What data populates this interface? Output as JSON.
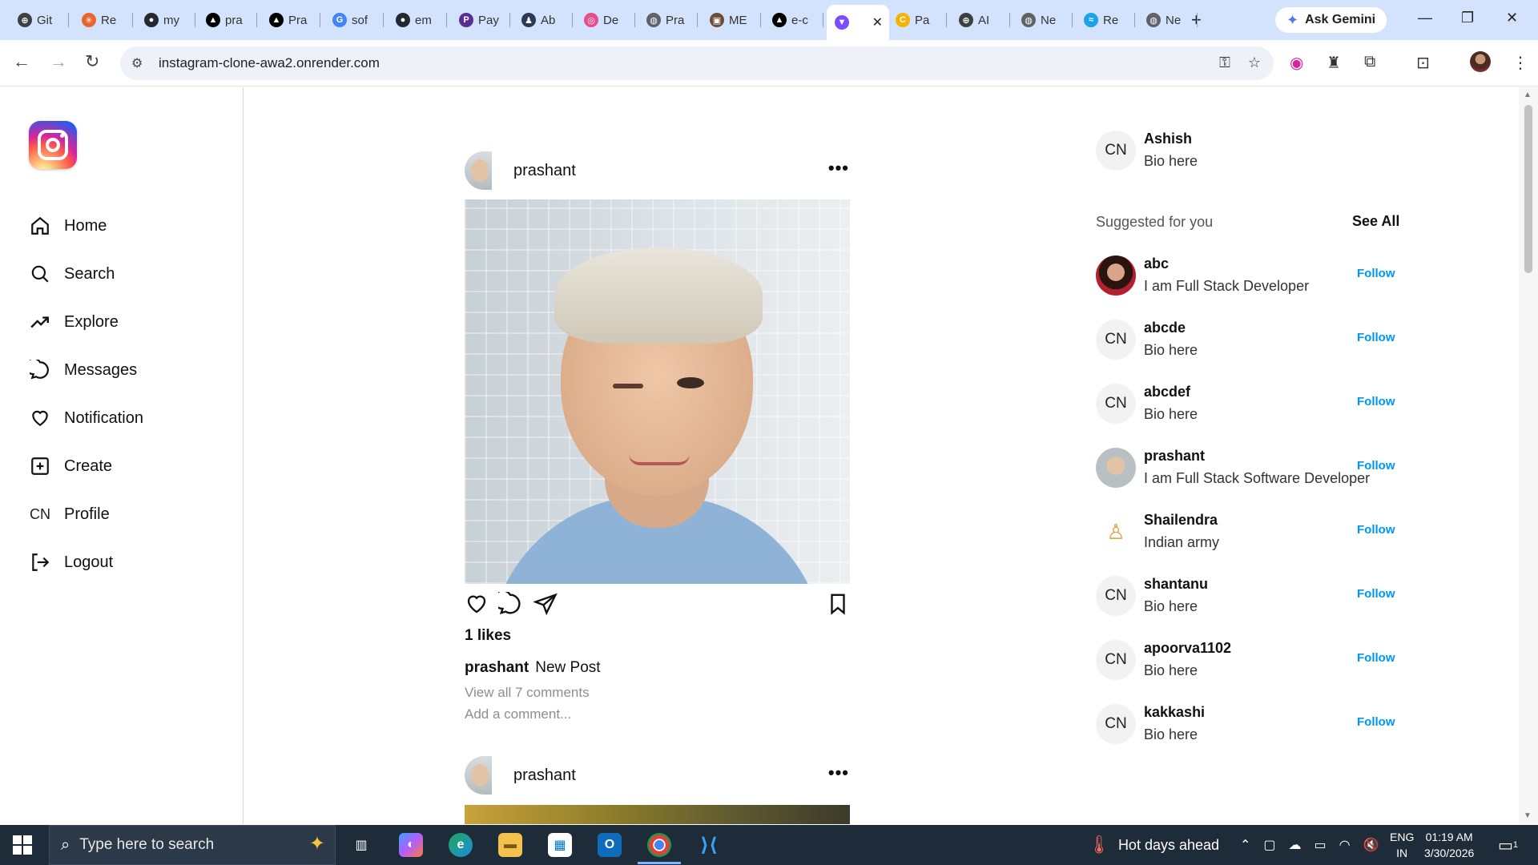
{
  "browser": {
    "tabs": [
      {
        "label": "Git",
        "fav": "#3c4043",
        "glyph": "⊕"
      },
      {
        "label": "Re",
        "fav": "#e8662e",
        "glyph": "✳"
      },
      {
        "label": "my",
        "fav": "#24292f",
        "glyph": "●"
      },
      {
        "label": "pra",
        "fav": "#000000",
        "glyph": "▲"
      },
      {
        "label": "Pra",
        "fav": "#000000",
        "glyph": "▲"
      },
      {
        "label": "sof",
        "fav": "#4285f4",
        "glyph": "G"
      },
      {
        "label": "em",
        "fav": "#24292f",
        "glyph": "●"
      },
      {
        "label": "Pay",
        "fav": "#5b2d8e",
        "glyph": "P"
      },
      {
        "label": "Ab",
        "fav": "#2b3a55",
        "glyph": "♟"
      },
      {
        "label": "De",
        "fav": "#ea4c89",
        "glyph": "◎"
      },
      {
        "label": "Pra",
        "fav": "#5f6368",
        "glyph": "◍"
      },
      {
        "label": "ME",
        "fav": "#6d4b3a",
        "glyph": "▣"
      },
      {
        "label": "e-c",
        "fav": "#000000",
        "glyph": "▲"
      },
      {
        "label": "",
        "fav": "#7c4dff",
        "glyph": "▼"
      },
      {
        "label": "Pa",
        "fav": "#f4b400",
        "glyph": "C"
      },
      {
        "label": "AI",
        "fav": "#3c4043",
        "glyph": "⊕"
      },
      {
        "label": "Ne",
        "fav": "#5f6368",
        "glyph": "◍"
      },
      {
        "label": "Re",
        "fav": "#1ba3e8",
        "glyph": "≈"
      },
      {
        "label": "Ne",
        "fav": "#5f6368",
        "glyph": "◍"
      }
    ],
    "ask_gemini": "Ask Gemini",
    "url": "instagram-clone-awa2.onrender.com"
  },
  "sidebar": {
    "items": [
      {
        "label": "Home",
        "icon": "home-icon"
      },
      {
        "label": "Search",
        "icon": "search-icon"
      },
      {
        "label": "Explore",
        "icon": "trending-icon"
      },
      {
        "label": "Messages",
        "icon": "message-icon"
      },
      {
        "label": "Notification",
        "icon": "heart-icon"
      },
      {
        "label": "Create",
        "icon": "plus-square-icon"
      },
      {
        "label": "Profile",
        "icon": "cn-avatar"
      },
      {
        "label": "Logout",
        "icon": "logout-icon"
      }
    ],
    "profile_initials": "CN"
  },
  "feed": {
    "post1": {
      "username": "prashant",
      "likes": "1 likes",
      "caption_user": "prashant",
      "caption_text": "New Post",
      "view_comments": "View all 7 comments",
      "add_comment": "Add a comment..."
    },
    "post2": {
      "username": "prashant"
    }
  },
  "right_panel": {
    "current_user": {
      "name": "Ashish",
      "bio": "Bio here",
      "initials": "CN"
    },
    "suggested_title": "Suggested for you",
    "see_all": "See All",
    "follow_label": "Follow",
    "suggestions": [
      {
        "name": "abc",
        "bio": "I am Full Stack Developer",
        "initials": ""
      },
      {
        "name": "abcde",
        "bio": "Bio here",
        "initials": "CN"
      },
      {
        "name": "abcdef",
        "bio": "Bio here",
        "initials": "CN"
      },
      {
        "name": "prashant",
        "bio": "I am Full Stack Software Developer",
        "initials": ""
      },
      {
        "name": "Shailendra",
        "bio": "Indian army",
        "initials": ""
      },
      {
        "name": "shantanu",
        "bio": "Bio here",
        "initials": "CN"
      },
      {
        "name": "apoorva1102",
        "bio": "Bio here",
        "initials": "CN"
      },
      {
        "name": "kakkashi",
        "bio": "Bio here",
        "initials": "CN"
      }
    ]
  },
  "taskbar": {
    "search_placeholder": "Type here to search",
    "weather": "Hot days ahead",
    "lang_top": "ENG",
    "lang_bottom": "IN",
    "time": "01:19 AM",
    "date": "3/30/2026",
    "notif_count": "1"
  }
}
